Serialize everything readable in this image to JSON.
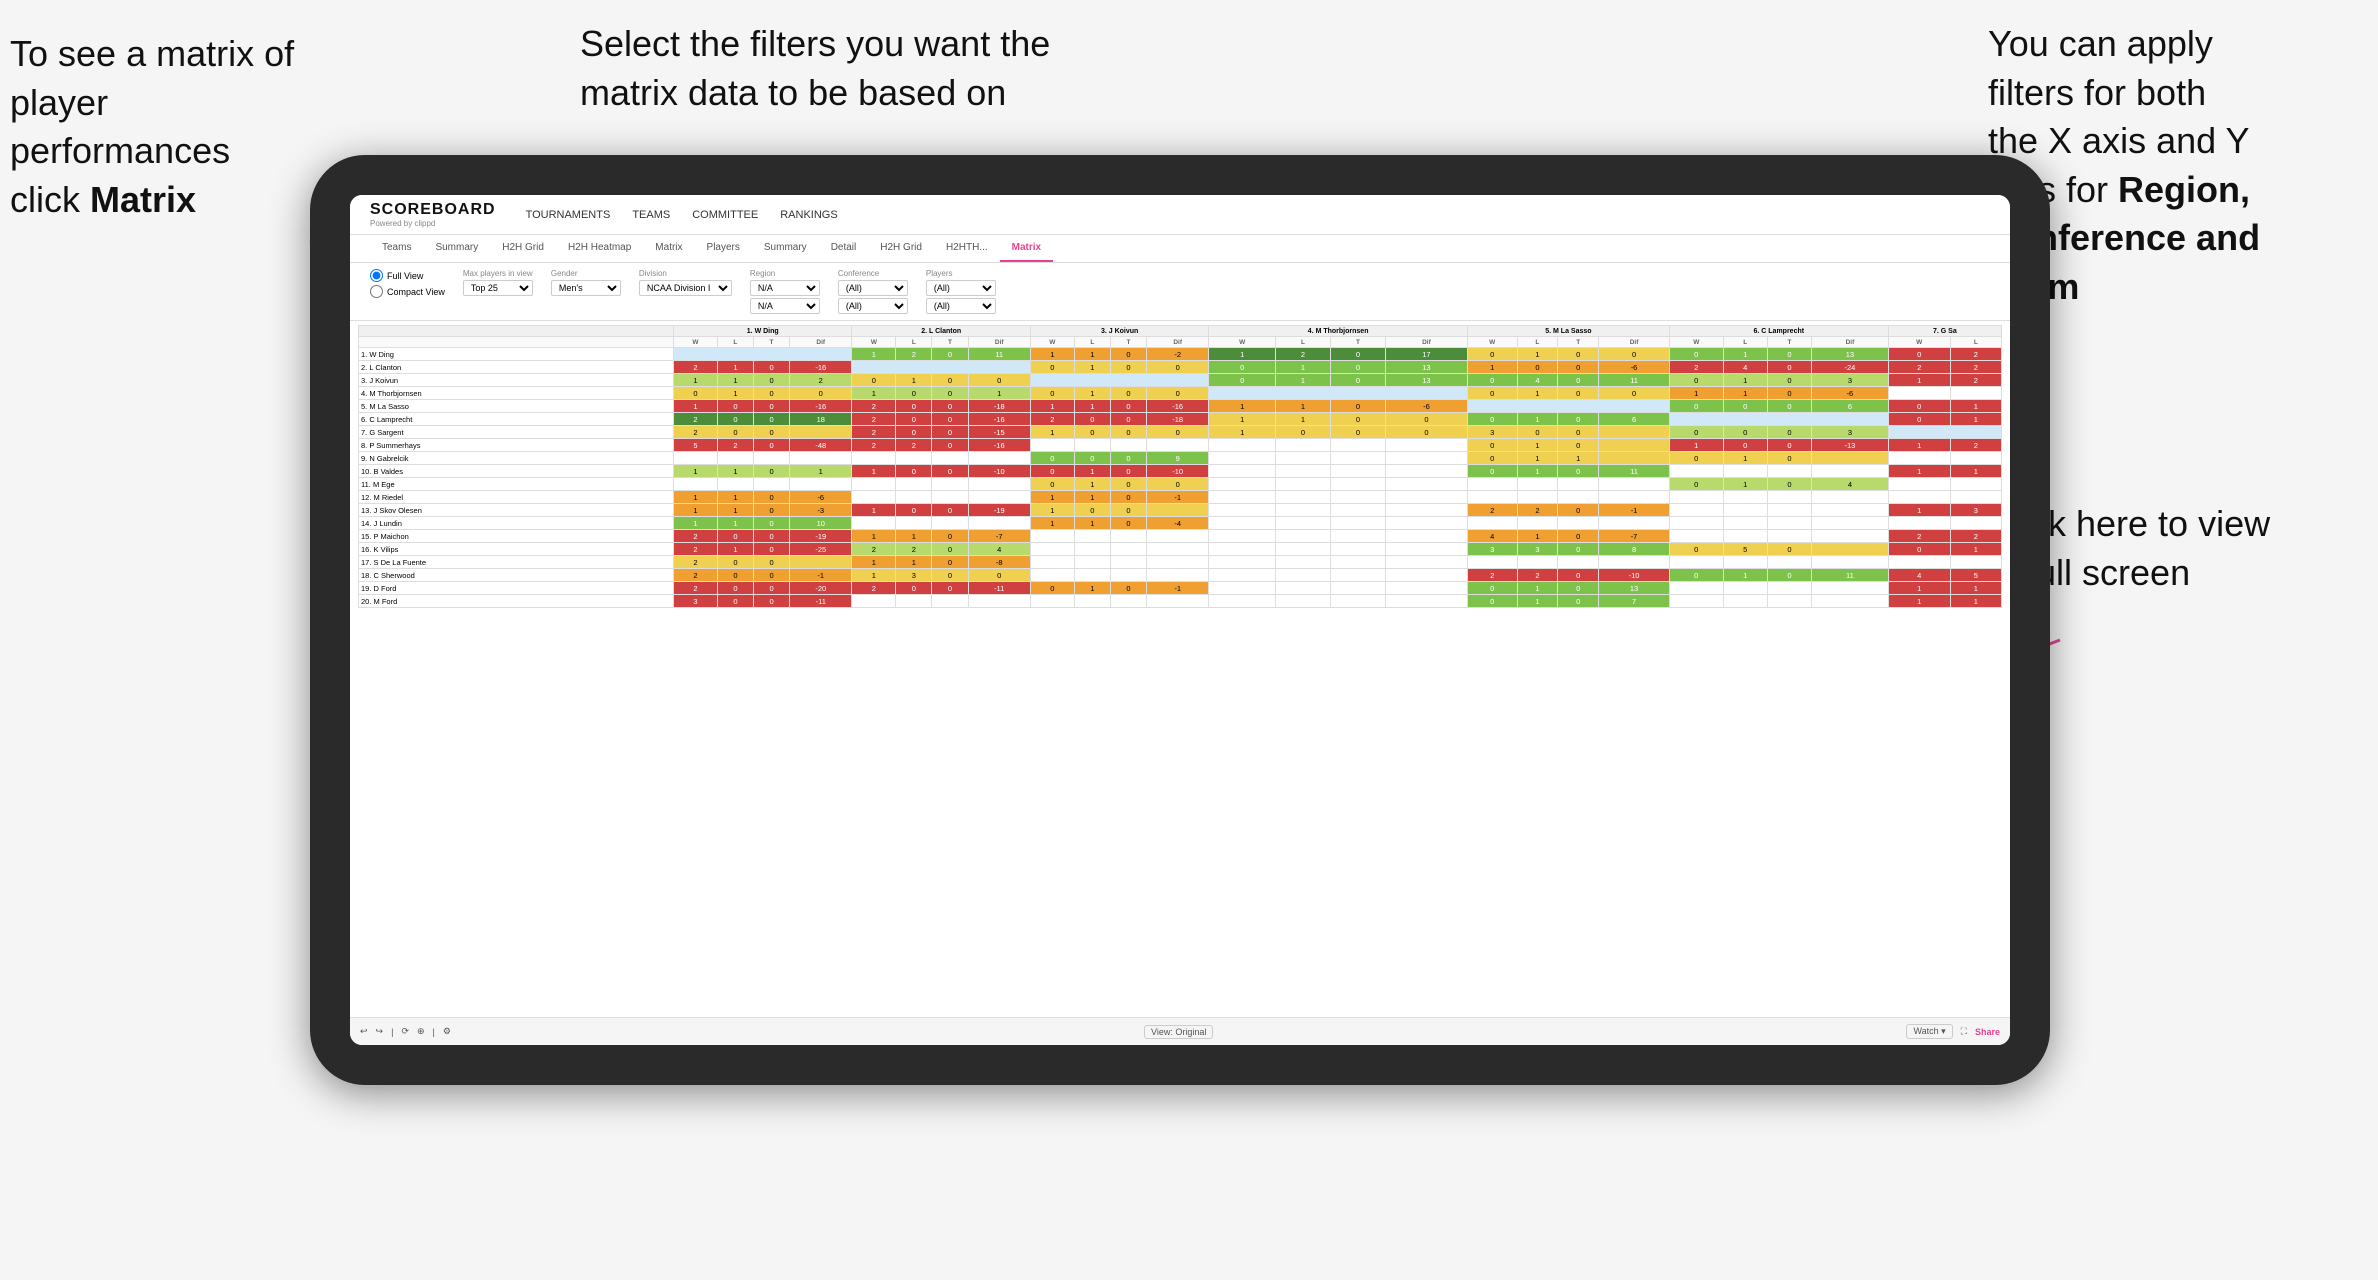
{
  "annotations": {
    "left": {
      "line1": "To see a matrix of",
      "line2": "player performances",
      "line3_normal": "click ",
      "line3_bold": "Matrix"
    },
    "center": {
      "text": "Select the filters you want the matrix data to be based on"
    },
    "right_top": {
      "line1": "You  can apply",
      "line2": "filters for both",
      "line3": "the X axis and Y",
      "line4_normal": "Axis for ",
      "line4_bold": "Region,",
      "line5_bold": "Conference and",
      "line6_bold": "Team"
    },
    "right_bottom": {
      "line1": "Click here to view",
      "line2": "in full screen"
    }
  },
  "app": {
    "logo": "SCOREBOARD",
    "logo_sub": "Powered by clippd",
    "nav": [
      "TOURNAMENTS",
      "TEAMS",
      "COMMITTEE",
      "RANKINGS"
    ],
    "tabs_outer": [
      "Teams",
      "Summary",
      "H2H Grid",
      "H2H Heatmap",
      "Matrix",
      "Players",
      "Summary",
      "Detail",
      "H2H Grid",
      "H2HTH...",
      "Matrix"
    ],
    "active_tab": "Matrix",
    "filters": {
      "view_full": "Full View",
      "view_compact": "Compact View",
      "max_players_label": "Max players in view",
      "max_players_value": "Top 25",
      "gender_label": "Gender",
      "gender_value": "Men's",
      "division_label": "Division",
      "division_value": "NCAA Division I",
      "region_label": "Region",
      "region_value": "N/A",
      "region_value2": "N/A",
      "conference_label": "Conference",
      "conference_value": "(All)",
      "conference_value2": "(All)",
      "players_label": "Players",
      "players_value": "(All)",
      "players_value2": "(All)"
    },
    "column_headers": [
      "1. W Ding",
      "2. L Clanton",
      "3. J Koivun",
      "4. M Thorbjornsen",
      "5. M La Sasso",
      "6. C Lamprecht",
      "7. G Sa"
    ],
    "sub_headers": [
      "W",
      "L",
      "T",
      "Dif"
    ],
    "players": [
      "1. W Ding",
      "2. L Clanton",
      "3. J Koivun",
      "4. M Thorbjornsen",
      "5. M La Sasso",
      "6. C Lamprecht",
      "7. G Sargent",
      "8. P Summerhays",
      "9. N Gabrelcik",
      "10. B Valdes",
      "11. M Ege",
      "12. M Riedel",
      "13. J Skov Olesen",
      "14. J Lundin",
      "15. P Maichon",
      "16. K Vilips",
      "17. S De La Fuente",
      "18. C Sherwood",
      "19. D Ford",
      "20. M Ford"
    ],
    "toolbar": {
      "view_original": "View: Original",
      "watch": "Watch ▾",
      "share": "Share"
    }
  }
}
